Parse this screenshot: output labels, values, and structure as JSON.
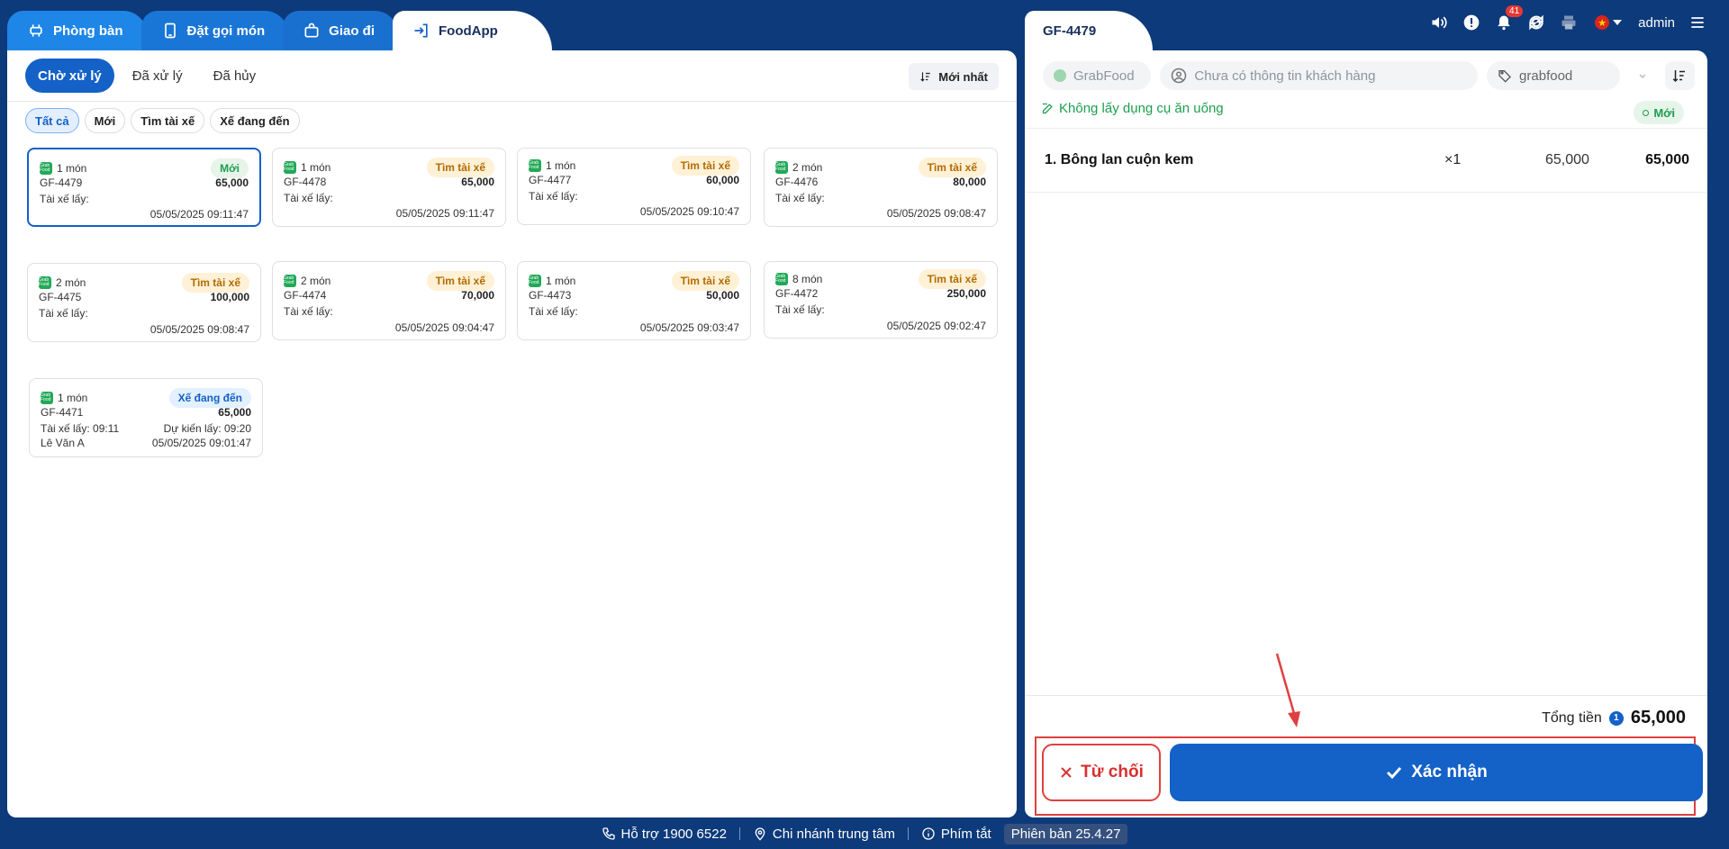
{
  "left_tabs": [
    {
      "label": "Phòng bàn",
      "icon": "table-icon"
    },
    {
      "label": "Đặt gọi món",
      "icon": "phone-order-icon"
    },
    {
      "label": "Giao đi",
      "icon": "bag-icon"
    },
    {
      "label": "FoodApp",
      "icon": "login-icon"
    }
  ],
  "subtabs": [
    "Chờ xử lý",
    "Đã xử lý",
    "Đã hủy"
  ],
  "sort_label": "Mới nhất",
  "filters": [
    "Tất cả",
    "Mới",
    "Tìm tài xế",
    "Xế đang đến"
  ],
  "orders": [
    {
      "items": "1 món",
      "status": "Mới",
      "code": "GF-4479",
      "amount": "65,000",
      "driver": "Tài xế lấy:",
      "expected": "",
      "driver_name": "",
      "time": "05/05/2025 09:11:47"
    },
    {
      "items": "1 món",
      "status": "Tìm tài xế",
      "code": "GF-4478",
      "amount": "65,000",
      "driver": "Tài xế lấy:",
      "expected": "",
      "driver_name": "",
      "time": "05/05/2025 09:11:47"
    },
    {
      "items": "1 món",
      "status": "Tìm tài xế",
      "code": "GF-4477",
      "amount": "60,000",
      "driver": "Tài xế lấy:",
      "expected": "",
      "driver_name": "",
      "time": "05/05/2025 09:10:47"
    },
    {
      "items": "2 món",
      "status": "Tìm tài xế",
      "code": "GF-4476",
      "amount": "80,000",
      "driver": "Tài xế lấy:",
      "expected": "",
      "driver_name": "",
      "time": "05/05/2025 09:08:47"
    },
    {
      "items": "2 món",
      "status": "Tìm tài xế",
      "code": "GF-4475",
      "amount": "100,000",
      "driver": "Tài xế lấy:",
      "expected": "",
      "driver_name": "",
      "time": "05/05/2025 09:08:47"
    },
    {
      "items": "2 món",
      "status": "Tìm tài xế",
      "code": "GF-4474",
      "amount": "70,000",
      "driver": "Tài xế lấy:",
      "expected": "",
      "driver_name": "",
      "time": "05/05/2025 09:04:47"
    },
    {
      "items": "1 món",
      "status": "Tìm tài xế",
      "code": "GF-4473",
      "amount": "50,000",
      "driver": "Tài xế lấy:",
      "expected": "",
      "driver_name": "",
      "time": "05/05/2025 09:03:47"
    },
    {
      "items": "8 món",
      "status": "Tìm tài xế",
      "code": "GF-4472",
      "amount": "250,000",
      "driver": "Tài xế lấy:",
      "expected": "",
      "driver_name": "",
      "time": "05/05/2025 09:02:47"
    },
    {
      "items": "1 món",
      "status": "Xế đang đến",
      "code": "GF-4471",
      "amount": "65,000",
      "driver": "Tài xế lấy: 09:11",
      "expected": "Dự kiến lấy: 09:20",
      "driver_name": "Lê Văn A",
      "time": "05/05/2025 09:01:47"
    }
  ],
  "detail": {
    "tab_label": "GF-4479",
    "source": "GrabFood",
    "customer_placeholder": "Chưa có thông tin khách hàng",
    "tag": "grabfood",
    "note": "Không lấy dụng cụ ăn uống",
    "status": "Mới",
    "items": [
      {
        "name": "1. Bông lan cuộn kem",
        "qty": "×1",
        "price": "65,000",
        "total": "65,000"
      }
    ],
    "total_label": "Tổng tiền",
    "total_info": "1",
    "total_value": "65,000",
    "reject_label": "Từ chối",
    "confirm_label": "Xác nhận"
  },
  "topbar": {
    "notifications": "41",
    "user": "admin"
  },
  "footer": {
    "support": "Hỗ trợ 1900 6522",
    "branch": "Chi nhánh trung tâm",
    "shortcuts": "Phím tắt",
    "version": "Phiên bản 25.4.27"
  },
  "colors": {
    "primary": "#1461c7",
    "background": "#0d3a7a",
    "success": "#1e9e4f",
    "danger": "#d9302f"
  }
}
